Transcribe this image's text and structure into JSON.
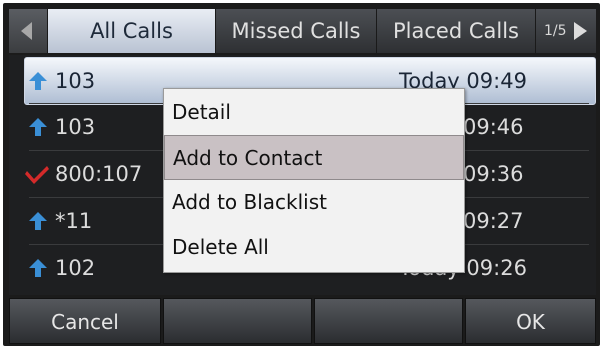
{
  "tabs": [
    {
      "label": "All Calls",
      "active": true
    },
    {
      "label": "Missed Calls",
      "active": false
    },
    {
      "label": "Placed Calls",
      "active": false
    }
  ],
  "pager": {
    "label": "1/5"
  },
  "calls": [
    {
      "number": "103",
      "time": "Today 09:49",
      "type": "placed",
      "icon": "placed-call-arrow-icon"
    },
    {
      "number": "103",
      "time": "09:46",
      "type": "placed",
      "icon": "placed-call-arrow-icon"
    },
    {
      "number": "800:107",
      "time": "09:36",
      "type": "missed",
      "icon": "missed-call-arrow-icon"
    },
    {
      "number": "*11",
      "time": "09:27",
      "type": "placed",
      "icon": "placed-call-arrow-icon"
    },
    {
      "number": "102",
      "time": "Today 09:26",
      "type": "placed",
      "icon": "placed-call-arrow-icon"
    }
  ],
  "context_menu": {
    "items": [
      {
        "label": "Detail"
      },
      {
        "label": "Add to Contact",
        "highlighted": true
      },
      {
        "label": "Add to Blacklist"
      },
      {
        "label": "Delete All"
      }
    ]
  },
  "softkeys": {
    "left": "Cancel",
    "right": "OK"
  },
  "colors": {
    "selected_row": "#aebdd3",
    "placed_icon": "#3a8fd6",
    "missed_icon": "#d42a2a",
    "menu_highlight": "#c9c1c4"
  }
}
